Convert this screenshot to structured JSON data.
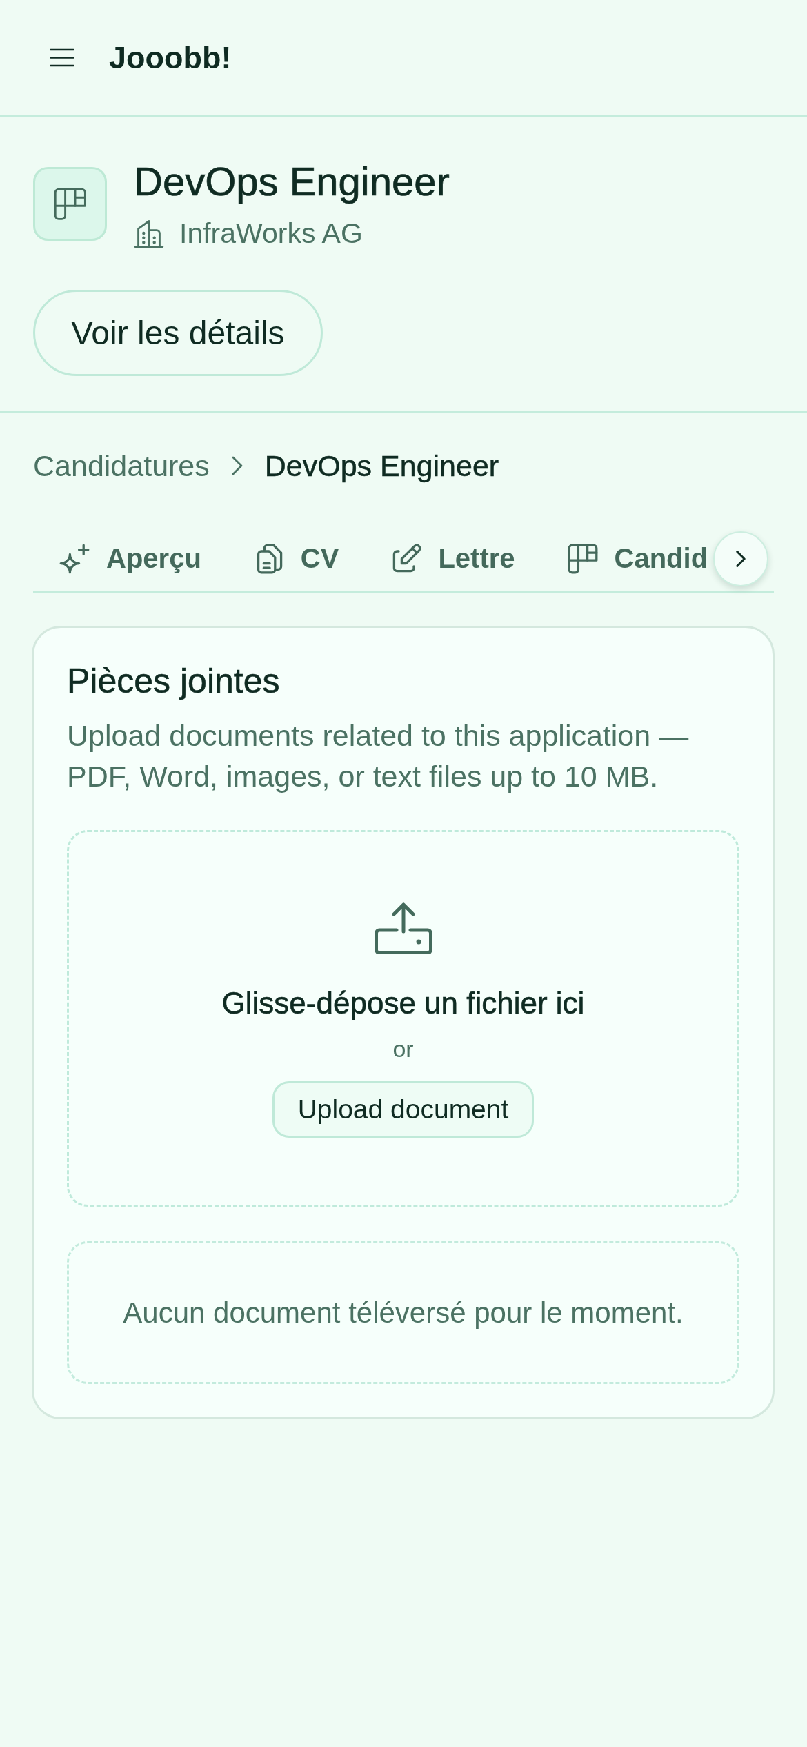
{
  "app_bar": {
    "title": "Jooobb!"
  },
  "job": {
    "title": "DevOps Engineer",
    "company": "InfraWorks AG",
    "details_button": "Voir les détails"
  },
  "breadcrumb": [
    "Candidatures",
    "DevOps Engineer"
  ],
  "tabs": [
    {
      "label": "Aperçu",
      "selected": false
    },
    {
      "label": "CV",
      "selected": false
    },
    {
      "label": "Lettre",
      "selected": false
    },
    {
      "label": "Candid",
      "selected": false
    }
  ],
  "attachments": {
    "title": "Pièces jointes",
    "description": "Upload documents related to this application — PDF, Word, images, or text files up to 10 MB.",
    "dropzone": {
      "title": "Glisse-dépose un fichier ici",
      "separator": "or",
      "button": "Upload document"
    },
    "empty_message": "Aucun document téléversé pour le moment."
  }
}
